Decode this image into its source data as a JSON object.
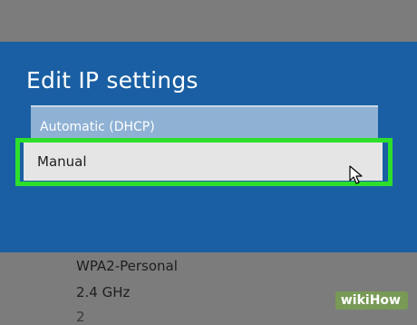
{
  "dialog": {
    "title": "Edit IP settings",
    "dropdown_selected": "Automatic (DHCP)",
    "option_manual": "Manual"
  },
  "background": {
    "security": "WPA2-Personal",
    "band": "2.4 GHz",
    "partial": "2"
  },
  "watermark": {
    "brand_prefix": "wiki",
    "brand_suffix": "How"
  },
  "colors": {
    "dialog_blue": "#1a5fa3",
    "highlight_green": "#2cdf2c",
    "page_gray": "#7c7c7c"
  }
}
